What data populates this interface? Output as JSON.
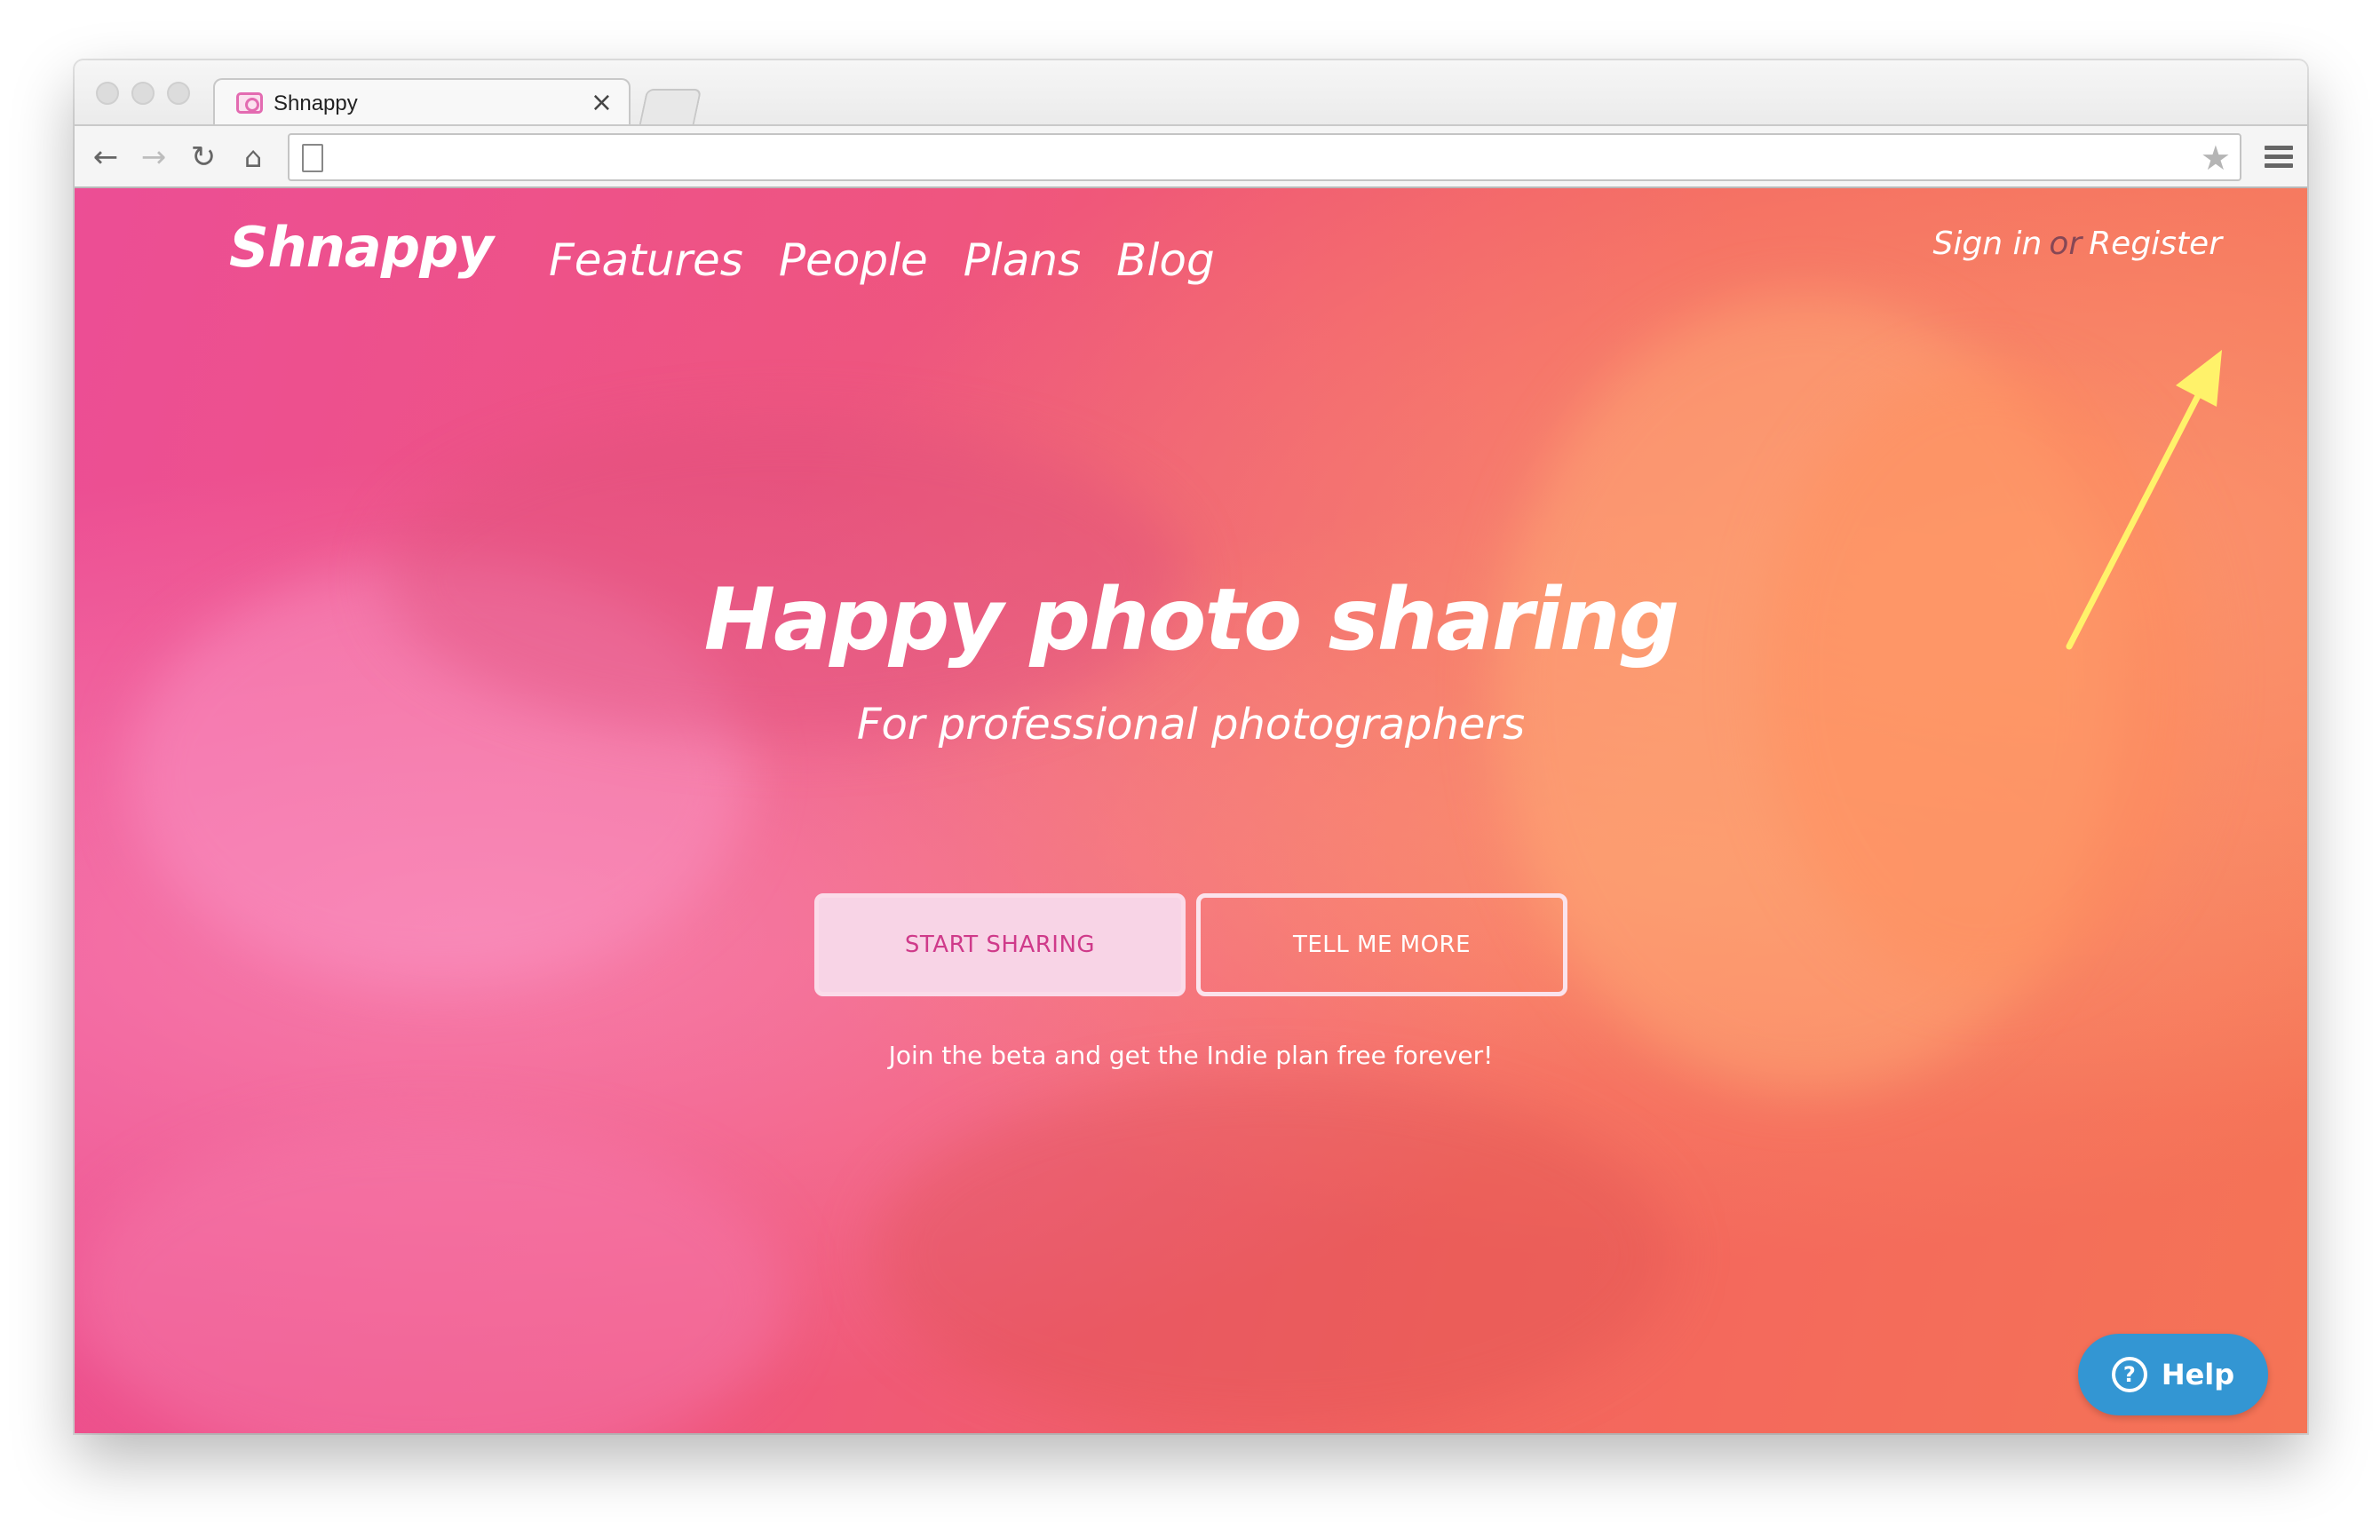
{
  "browser": {
    "tab_title": "Shnappy",
    "tab_close": "×",
    "url": ""
  },
  "site": {
    "logo": "Shnappy",
    "nav": [
      "Features",
      "People",
      "Plans",
      "Blog"
    ],
    "auth": {
      "sign_in": "Sign in",
      "or": "or",
      "register": "Register"
    }
  },
  "hero": {
    "title": "Happy photo sharing",
    "subtitle": "For professional photographers",
    "primary_button": "START SHARING",
    "secondary_button": "TELL ME MORE",
    "tagline": "Join the beta and get the Indie plan free forever!"
  },
  "help": {
    "label": "Help",
    "icon_glyph": "?"
  },
  "colors": {
    "accent_pink": "#ec4e95",
    "accent_orange": "#f57456",
    "help_blue": "#3396d3",
    "arrow_yellow": "#fff26a"
  }
}
